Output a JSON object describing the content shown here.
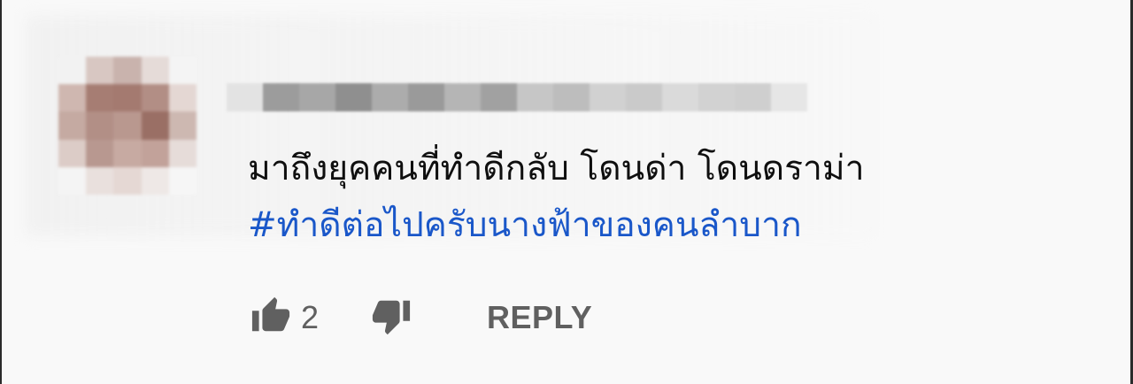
{
  "comment": {
    "author_name": "",
    "text": "มาถึงยุคคนที่ทำดีกลับ โดนด่า โดนดราม่า",
    "hashtag": "#ทำดีต่อไปครับนางฟ้าของคนลำบาก",
    "like_count": "2",
    "reply_label": "REPLY"
  },
  "icons": {
    "like": "thumb-up-icon",
    "dislike": "thumb-down-icon"
  },
  "colors": {
    "text": "#0f0f0f",
    "hashtag": "#1a57c9",
    "action": "#606060",
    "background": "#f9f9f9"
  }
}
